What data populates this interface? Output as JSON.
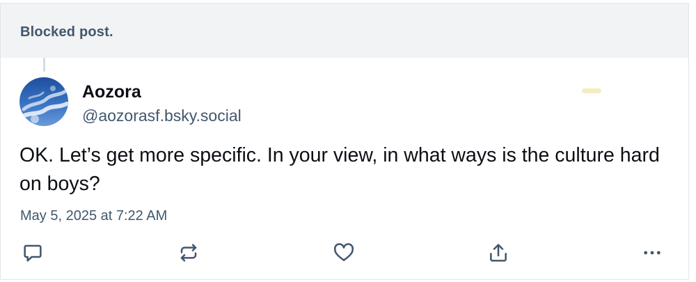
{
  "blocked_notice": "Blocked post.",
  "author": {
    "display_name": "Aozora",
    "handle": "@aozorasf.bsky.social"
  },
  "post": {
    "text": "OK. Let’s get more specific. In your view, in what ways is the culture hard on boys?",
    "timestamp": "May 5, 2025 at 7:22 AM"
  },
  "actions": {
    "reply": "reply-icon",
    "repost": "repost-icon",
    "like": "heart-icon",
    "share": "share-icon",
    "more": "more-options-icon"
  },
  "colors": {
    "text_primary": "#0b0f14",
    "text_secondary": "#42576c",
    "blocked_bg": "#f1f3f5",
    "border": "#dfe5ec",
    "icon": "#42576c"
  }
}
